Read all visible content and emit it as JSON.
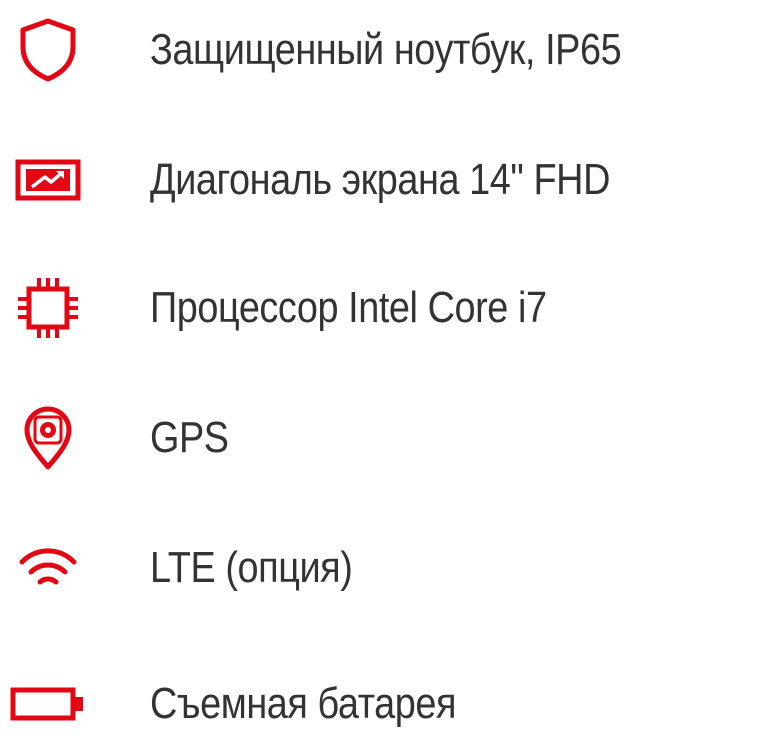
{
  "accent_color": "#e30613",
  "text_color": "#333333",
  "features": [
    {
      "icon": "shield-icon",
      "label": "Защищенный ноутбук, IP65"
    },
    {
      "icon": "display-icon",
      "label": "Диагональ экрана 14\" FHD"
    },
    {
      "icon": "cpu-chip-icon",
      "label": "Процессор Intel Core i7"
    },
    {
      "icon": "location-pin-icon",
      "label": "GPS"
    },
    {
      "icon": "wifi-signal-icon",
      "label": "LTE (опция)"
    },
    {
      "icon": "battery-icon",
      "label": "Съемная батарея"
    }
  ]
}
